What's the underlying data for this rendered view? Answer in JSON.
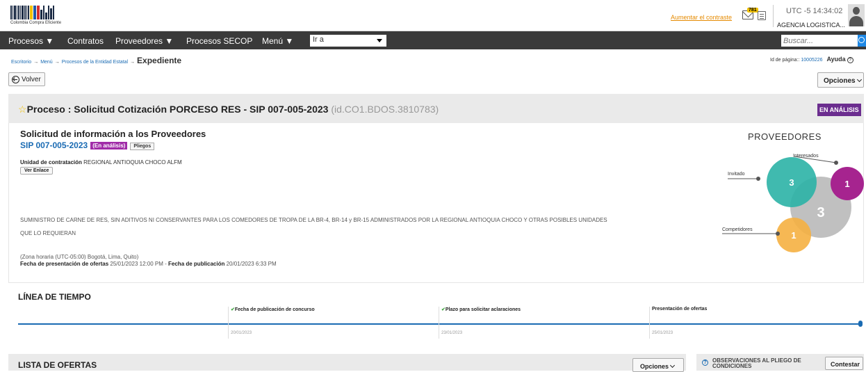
{
  "header": {
    "logo_caption": "Colombia Compra Eficiente",
    "contrast_link": "Aumentar el contraste",
    "notifications_count": "781",
    "timezone_clock": "UTC -5 14:34:02",
    "agency": "AGENCIA LOGISTICA..."
  },
  "nav": {
    "items": [
      "Procesos ▼",
      "Contratos",
      "Proveedores ▼",
      "Procesos SECOP",
      "Menú ▼"
    ],
    "goto_value": "Ir a",
    "search_placeholder": "Buscar..."
  },
  "breadcrumb": {
    "items": [
      "Escritorio",
      "Menú",
      "Procesos de la Entidad Estatal"
    ],
    "current": "Expediente",
    "separator": "→"
  },
  "page_id": {
    "label": "Id de página::",
    "value": "10005226",
    "help": "Ayuda"
  },
  "actions": {
    "back": "Volver",
    "options": "Opciones"
  },
  "process": {
    "title": "Proceso : Solicitud Cotización PORCESO RES - SIP 007-005-2023",
    "id": "(id.CO1.BDOS.3810783)",
    "status": "EN ANÁLISIS",
    "request_title": "Solicitud de información a los Proveedores",
    "reference": "SIP 007-005-2023",
    "state_tag": "(En análisis)",
    "pliegos_tag": "Pliegos",
    "unit_label": "Unidad de contratación",
    "unit_value": "REGIONAL ANTIOQUIA CHOCO ALFM",
    "link_button": "Ver Enlace",
    "description": "SUMINISTRO DE CARNE DE RES, SIN ADITIVOS NI CONSERVANTES PARA LOS COMEDORES DE TROPA DE LA BR-4, BR-14 y BR-15 ADMINISTRADOS POR LA REGIONAL ANTIOQUIA CHOCO Y OTRAS POSIBLES UNIDADES QUE LO REQUIERAN",
    "timezone": "(Zona horaria (UTC-05:00) Bogotá, Lima, Quito)",
    "offers_date_label": "Fecha de presentación de ofertas",
    "offers_date": "25/01/2023 12:00 PM",
    "pub_date_label": "Fecha de publicación",
    "pub_date": "20/01/2023 6:33 PM"
  },
  "providers": {
    "title": "PROVEEDORES",
    "bubbles": [
      {
        "label": "Interesados",
        "value": "3",
        "color": "#b5b5b5"
      },
      {
        "label": "Invitado",
        "value": "3",
        "color": "#2bb3a6"
      },
      {
        "label": "",
        "value": "1",
        "color": "#a6248f"
      },
      {
        "label": "Competidores",
        "value": "1",
        "color": "#f5b041"
      }
    ]
  },
  "timeline": {
    "title": "LÍNEA DE TIEMPO",
    "milestones": [
      {
        "label": "Fecha de publicación de concurso",
        "date": "20/01/2023",
        "done": true
      },
      {
        "label": "Plazo para solicitar aclaraciones",
        "date": "23/01/2023",
        "done": true
      },
      {
        "label": "Presentación de ofertas",
        "date": "25/01/2023",
        "done": false
      }
    ]
  },
  "offers_list": {
    "title": "LISTA DE OFERTAS",
    "options": "Opciones"
  },
  "observations": {
    "line1": "OBSERVACIONES AL PLIEGO DE",
    "line2": "CONDICIONES",
    "reply": "Contestar"
  },
  "colors": {
    "primary_blue": "#1a6bb3",
    "status_purple": "#6b2d8f",
    "navbar": "#3a3a3a"
  }
}
